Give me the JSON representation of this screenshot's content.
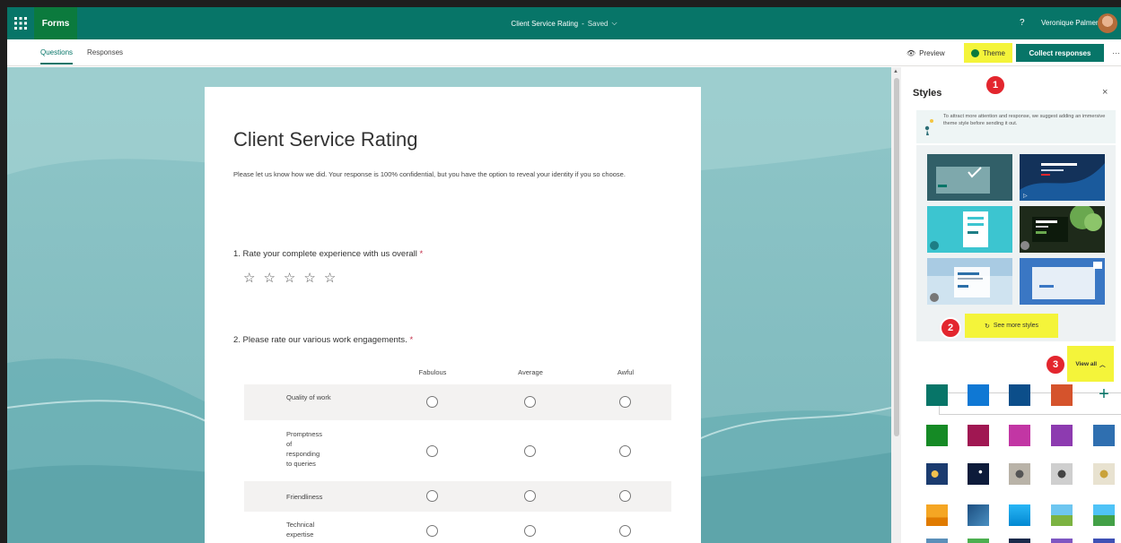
{
  "app": {
    "brand": "Forms",
    "doc_title": "Client Service Rating",
    "separator": "-",
    "save_status": "Saved",
    "help": "?",
    "user_name": "Veronique Palmer"
  },
  "tabs": {
    "questions": "Questions",
    "responses": "Responses"
  },
  "toolbar": {
    "preview": "Preview",
    "theme": "Theme",
    "collect": "Collect responses",
    "more": "···"
  },
  "form": {
    "title": "Client Service Rating",
    "description": "Please let us know how we did. Your response is 100% confidential, but you have the option to reveal your identity if you so choose.",
    "q1": {
      "text": "1. Rate your complete experience with us overall",
      "required_mark": "*",
      "stars": 5
    },
    "q2": {
      "text": "2. Please rate our various work engagements.",
      "required_mark": "*",
      "columns": [
        "Fabulous",
        "Average",
        "Awful"
      ],
      "rows": [
        "Quality of work",
        "Promptness of responding to queries",
        "Friendliness",
        "Technical expertise"
      ]
    }
  },
  "styles_panel": {
    "title": "Styles",
    "close": "×",
    "tip": "To attract more attention and response, we suggest adding an immersive theme style before sending it out.",
    "see_more": "See more styles",
    "view_all": "View all",
    "swatch_colors": [
      "#077568",
      "#0f78d4",
      "#0c4e8a",
      "#d5532c",
      "#158a25",
      "#a01752",
      "#c236a4",
      "#8d3bb0",
      "#2f6fb0"
    ]
  },
  "annotations": [
    "1",
    "2",
    "3"
  ]
}
